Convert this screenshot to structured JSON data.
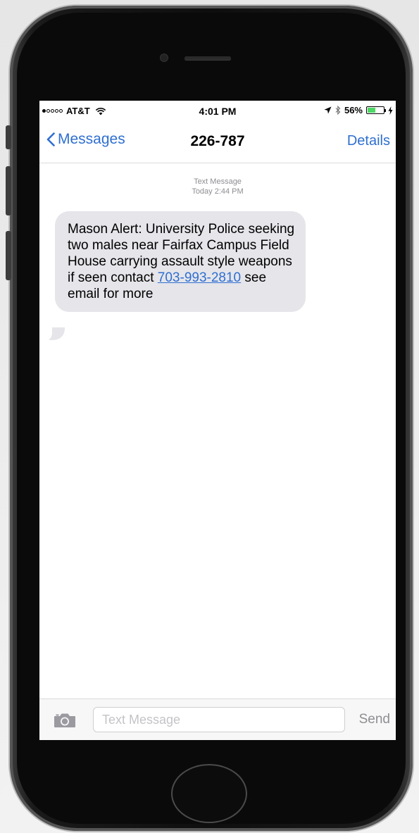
{
  "status_bar": {
    "carrier": "AT&T",
    "time": "4:01 PM",
    "battery_percent": "56%",
    "battery_level": 0.56,
    "signal_bars": 1,
    "signal_total": 5,
    "icons": [
      "wifi-icon",
      "location-icon",
      "bluetooth-icon",
      "battery-icon",
      "charging-icon"
    ]
  },
  "nav": {
    "back_label": "Messages",
    "title": "226-787",
    "details_label": "Details"
  },
  "conversation": {
    "meta_type": "Text Message",
    "meta_time": "Today 2:44 PM",
    "message": {
      "text_before": "Mason Alert: University Police seeking two males near Fairfax Campus Field House carrying assault style weapons if seen contact ",
      "link": "703-993-2810",
      "text_after": " see email for more"
    }
  },
  "compose": {
    "placeholder": "Text Message",
    "value": "",
    "send_label": "Send"
  },
  "colors": {
    "accent": "#2f6fd0",
    "bubble": "#e5e5ea",
    "battery": "#4cd964"
  }
}
